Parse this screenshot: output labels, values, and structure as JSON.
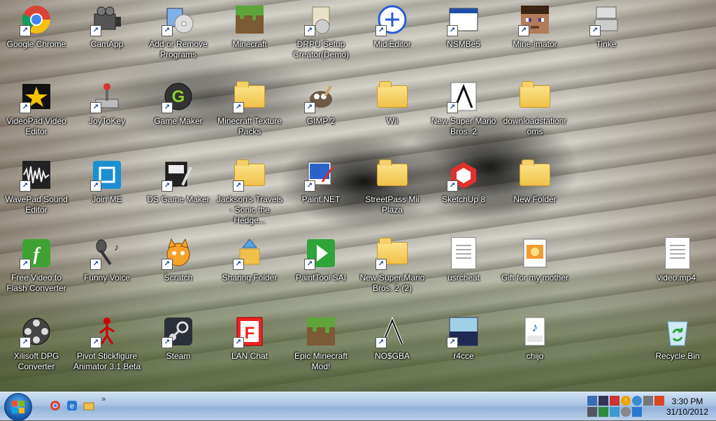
{
  "desktop": {
    "icons": [
      {
        "label": "Google Chrome",
        "icon": "chrome-icon"
      },
      {
        "label": "CamApp",
        "icon": "camera-icon"
      },
      {
        "label": "Add or Remove Programs",
        "icon": "add-remove-programs-icon"
      },
      {
        "label": "Minecraft",
        "icon": "minecraft-block-icon"
      },
      {
        "label": "DRPU Setup Creator(Demo)",
        "icon": "setup-box-icon"
      },
      {
        "label": "MidiEditor",
        "icon": "midi-editor-icon"
      },
      {
        "label": "NSMBe5",
        "icon": "app-window-icon"
      },
      {
        "label": "Mine-imator",
        "icon": "minecraft-face-icon"
      },
      {
        "label": "Tinke",
        "icon": "nintendo-ds-icon"
      },
      {
        "label": "VideoPad Video Editor",
        "icon": "videopad-star-icon"
      },
      {
        "label": "JoyToKey",
        "icon": "joystick-icon"
      },
      {
        "label": "Game Maker",
        "icon": "game-maker-icon"
      },
      {
        "label": "Minecraft Texture Packs",
        "icon": "folder-icon"
      },
      {
        "label": "GIMP 2",
        "icon": "gimp-icon"
      },
      {
        "label": "Wii",
        "icon": "folder-icon"
      },
      {
        "label": "New Super Mario Bros. 2",
        "icon": "nosgba-icon"
      },
      {
        "label": "downloadstationr oms",
        "icon": "folder-icon"
      },
      {
        "label": "WavePad Sound Editor",
        "icon": "waveform-icon"
      },
      {
        "label": "Join ME",
        "icon": "join-me-icon"
      },
      {
        "label": "DS Game Maker",
        "icon": "ds-game-maker-icon"
      },
      {
        "label": "Jackson's Travels - Sonic the Hedge...",
        "icon": "folder-icon"
      },
      {
        "label": "Paint.NET",
        "icon": "paint-net-icon"
      },
      {
        "label": "StreetPass Mii Plaza",
        "icon": "folder-icon"
      },
      {
        "label": "SketchUp 8",
        "icon": "sketchup-icon"
      },
      {
        "label": "New Folder",
        "icon": "folder-icon"
      },
      {
        "label": "Free Video to Flash Converter",
        "icon": "flash-icon"
      },
      {
        "label": "Funny Voice",
        "icon": "microphone-icon"
      },
      {
        "label": "Scratch",
        "icon": "scratch-cat-icon"
      },
      {
        "label": "Sharing Folder",
        "icon": "sharing-folder-icon"
      },
      {
        "label": "PaintTool SAI",
        "icon": "play-green-icon"
      },
      {
        "label": "New Super Mario Bros. 2 (2)",
        "icon": "folder-icon"
      },
      {
        "label": "usrcheat",
        "icon": "document-icon"
      },
      {
        "label": "Gift for my mother",
        "icon": "image-file-icon"
      },
      {
        "label": "video.mp4.",
        "icon": "document-icon"
      },
      {
        "label": "Xilisoft DPG Converter",
        "icon": "film-reel-icon"
      },
      {
        "label": "Pivot Stickfigure Animator 3.1 Beta",
        "icon": "stick-figure-icon"
      },
      {
        "label": "Steam",
        "icon": "steam-icon"
      },
      {
        "label": "LAN Chat",
        "icon": "lan-chat-icon"
      },
      {
        "label": "Epic Minecraft Mod!",
        "icon": "minecraft-block-icon"
      },
      {
        "label": "NO$GBA",
        "icon": "nosgba-icon"
      },
      {
        "label": "r4cce",
        "icon": "r4-icon"
      },
      {
        "label": "chijo",
        "icon": "wav-file-icon"
      },
      {
        "label": "Recycle Bin",
        "icon": "recycle-bin-icon"
      }
    ]
  },
  "taskbar": {
    "start_icon": "windows-start-orb",
    "quick_launch": [
      "chrome-icon",
      "ie-icon",
      "explorer-icon"
    ],
    "overflow_label": "»",
    "clock": {
      "time": "3:30 PM",
      "date": "31/10/2012"
    }
  }
}
